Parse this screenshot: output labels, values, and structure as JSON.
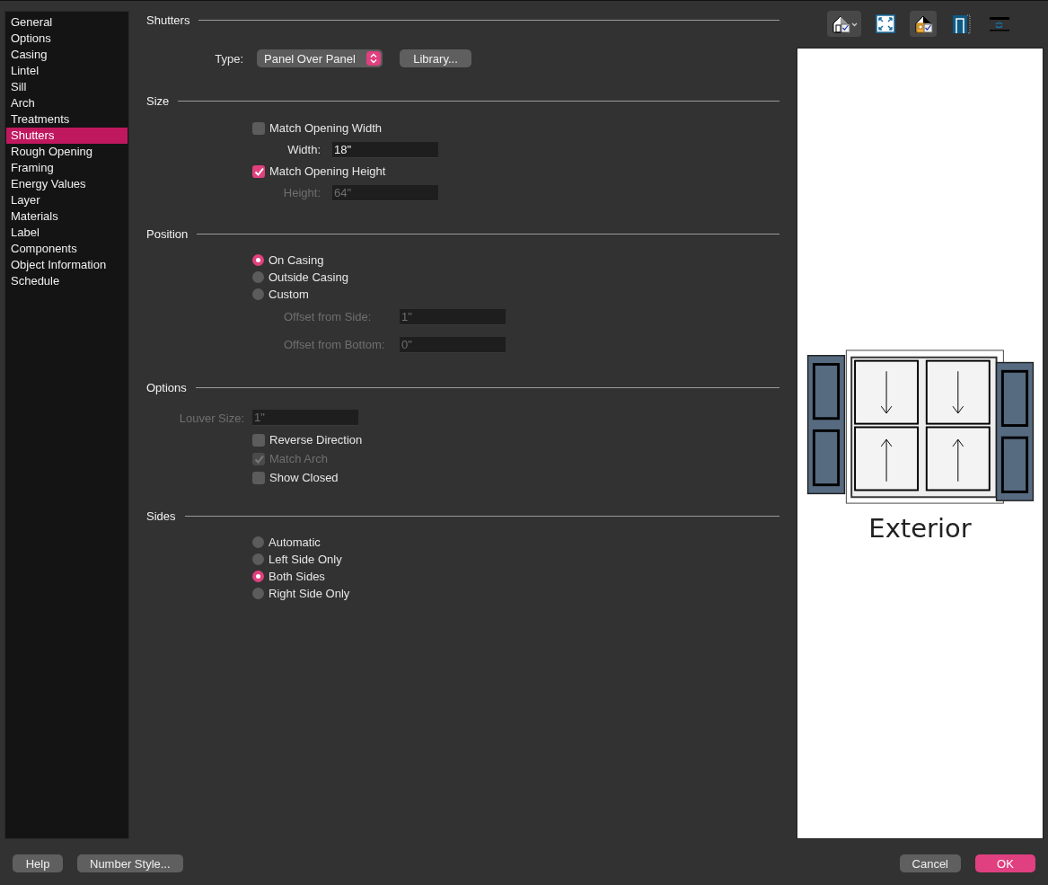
{
  "sidebar": {
    "items": [
      {
        "label": "General",
        "selected": false
      },
      {
        "label": "Options",
        "selected": false
      },
      {
        "label": "Casing",
        "selected": false
      },
      {
        "label": "Lintel",
        "selected": false
      },
      {
        "label": "Sill",
        "selected": false
      },
      {
        "label": "Arch",
        "selected": false
      },
      {
        "label": "Treatments",
        "selected": false
      },
      {
        "label": "Shutters",
        "selected": true
      },
      {
        "label": "Rough Opening",
        "selected": false
      },
      {
        "label": "Framing",
        "selected": false
      },
      {
        "label": "Energy Values",
        "selected": false
      },
      {
        "label": "Layer",
        "selected": false
      },
      {
        "label": "Materials",
        "selected": false
      },
      {
        "label": "Label",
        "selected": false
      },
      {
        "label": "Components",
        "selected": false
      },
      {
        "label": "Object Information",
        "selected": false
      },
      {
        "label": "Schedule",
        "selected": false
      }
    ]
  },
  "sections": [
    {
      "title": "Shutters",
      "rows": [
        {
          "kind": "dropdown",
          "label": "Type:",
          "value": "Panel Over Panel",
          "button": "Library..."
        }
      ]
    },
    {
      "title": "Size",
      "rows": [
        {
          "kind": "checkbox",
          "label": "Match Opening Width",
          "checked": false,
          "disabled": false
        },
        {
          "kind": "field",
          "label": "Width:",
          "value": "18\"",
          "disabled": false
        },
        {
          "kind": "checkbox",
          "label": "Match Opening Height",
          "checked": true,
          "disabled": false
        },
        {
          "kind": "field",
          "label": "Height:",
          "value": "64\"",
          "disabled": true
        }
      ]
    },
    {
      "title": "Position",
      "rows": [
        {
          "kind": "radio",
          "label": "On Casing",
          "selected": true
        },
        {
          "kind": "radio",
          "label": "Outside Casing",
          "selected": false
        },
        {
          "kind": "radio",
          "label": "Custom",
          "selected": false
        },
        {
          "kind": "subfield",
          "label": "Offset from Side:",
          "value": "1\"",
          "disabled": true
        },
        {
          "kind": "subfield",
          "label": "Offset from Bottom:",
          "value": "0\"",
          "disabled": true
        }
      ]
    },
    {
      "title": "Options",
      "rows": [
        {
          "kind": "inlinefield",
          "label": "Louver Size:",
          "value": "1\"",
          "disabled": true
        },
        {
          "kind": "checkbox",
          "label": "Reverse Direction",
          "checked": false,
          "disabled": false
        },
        {
          "kind": "checkbox",
          "label": "Match Arch",
          "checked": true,
          "disabled": true
        },
        {
          "kind": "checkbox",
          "label": "Show Closed",
          "checked": false,
          "disabled": false
        }
      ]
    },
    {
      "title": "Sides",
      "rows": [
        {
          "kind": "radio",
          "label": "Automatic",
          "selected": false
        },
        {
          "kind": "radio",
          "label": "Left Side Only",
          "selected": false
        },
        {
          "kind": "radio",
          "label": "Both Sides",
          "selected": true
        },
        {
          "kind": "radio",
          "label": "Right Side Only",
          "selected": false
        }
      ]
    }
  ],
  "preview": {
    "toolbar": [
      {
        "kind": "view-menu",
        "active": true
      },
      {
        "kind": "fit",
        "active": false
      },
      {
        "kind": "elevation",
        "active": true
      },
      {
        "kind": "frame",
        "active": false
      },
      {
        "kind": "flip",
        "active": false
      }
    ],
    "caption": "Exterior"
  },
  "footer": {
    "left": [
      {
        "label": "Help",
        "primary": false
      },
      {
        "label": "Number Style...",
        "primary": false
      }
    ],
    "right": [
      {
        "label": "Cancel",
        "primary": false
      },
      {
        "label": "OK",
        "primary": true
      }
    ]
  }
}
